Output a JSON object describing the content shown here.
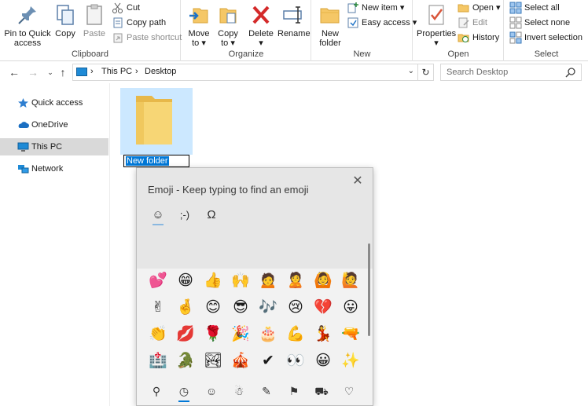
{
  "ribbon": {
    "clipboard": {
      "label": "Clipboard",
      "pin_line1": "Pin to Quick",
      "pin_line2": "access",
      "copy": "Copy",
      "paste": "Paste",
      "cut": "Cut",
      "copy_path": "Copy path",
      "paste_shortcut": "Paste shortcut"
    },
    "organize": {
      "label": "Organize",
      "move_to": "Move",
      "move_to_2": "to",
      "copy_to": "Copy",
      "copy_to_2": "to",
      "delete": "Delete",
      "rename": "Rename"
    },
    "new": {
      "label": "New",
      "new_folder_1": "New",
      "new_folder_2": "folder",
      "new_item": "New item",
      "easy_access": "Easy access"
    },
    "open": {
      "label": "Open",
      "properties": "Properties",
      "open": "Open",
      "edit": "Edit",
      "history": "History"
    },
    "select": {
      "label": "Select",
      "select_all": "Select all",
      "select_none": "Select none",
      "invert_selection": "Invert selection"
    }
  },
  "address": {
    "segments": [
      "This PC",
      "Desktop"
    ],
    "search_placeholder": "Search Desktop"
  },
  "nav": {
    "items": [
      {
        "label": "Quick access"
      },
      {
        "label": "OneDrive"
      },
      {
        "label": "This PC"
      },
      {
        "label": "Network"
      }
    ]
  },
  "content": {
    "rename_value": "New folder"
  },
  "emoji_panel": {
    "title": "Emoji - Keep typing to find an emoji",
    "modes": [
      "☺",
      ";-)",
      "Ω"
    ],
    "rows": [
      [
        "💕",
        "😁",
        "👍",
        "🙌",
        "🙍",
        "🙎",
        "🙆",
        "🙋"
      ],
      [
        "✌",
        "🤞",
        "😊",
        "😎",
        "🎶",
        "😢",
        "💔",
        "😛"
      ],
      [
        "👏",
        "💋",
        "🌹",
        "🎉",
        "🎂",
        "💪",
        "💃",
        "🔫"
      ],
      [
        "🏥",
        "🐊",
        "🏞",
        "🎪",
        "✔",
        "👀",
        "😀",
        "✨"
      ]
    ],
    "categories": [
      "search",
      "recent",
      "smiley",
      "people",
      "balloon",
      "pizza",
      "car",
      "heart"
    ],
    "category_glyphs": [
      "⚲",
      "◷",
      "☺",
      "☃",
      "✎",
      "⚑",
      "⛟",
      "♡"
    ]
  }
}
